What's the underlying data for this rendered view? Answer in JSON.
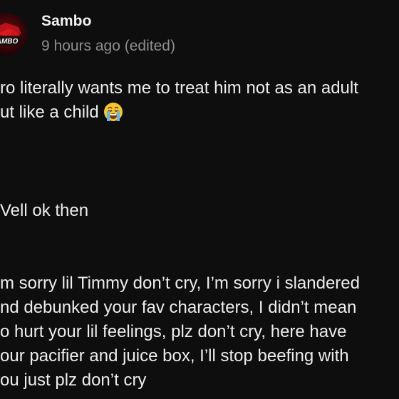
{
  "post": {
    "author": "Sambo",
    "timestamp": "9 hours ago (edited)",
    "avatar_text": "AMBO",
    "emoji": "loudly-crying-face",
    "paragraphs": [
      {
        "lines": [
          "ro literally wants me to treat him not as an adult",
          "ut like a child"
        ]
      },
      {
        "lines": [
          "Vell ok then"
        ]
      },
      {
        "lines": [
          "m sorry lil Timmy don’t cry, I’m sorry i slandered",
          "nd debunked your fav characters, I didn’t mean",
          "o hurt your lil feelings, plz don’t cry, here have",
          "our pacifier and juice box, I’ll stop beefing with",
          "ou just plz don’t cry"
        ]
      }
    ]
  }
}
